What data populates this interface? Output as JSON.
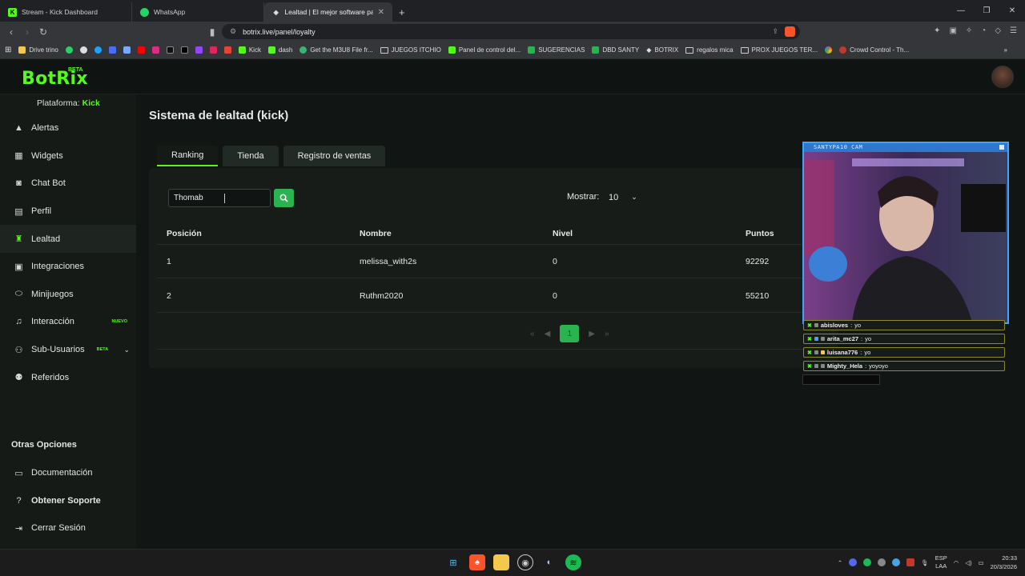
{
  "browser": {
    "tabs": [
      {
        "label": "Stream - Kick Dashboard"
      },
      {
        "label": "WhatsApp"
      },
      {
        "label": "Lealtad | El mejor software para ..."
      }
    ],
    "url": "botrix.live/panel/loyalty",
    "bookmarks": [
      {
        "label": "Drive trino"
      },
      {
        "label": "Kick"
      },
      {
        "label": "dash"
      },
      {
        "label": "Get the M3U8 File fr..."
      },
      {
        "label": "JUEGOS ITCHIO"
      },
      {
        "label": "Panel de control del..."
      },
      {
        "label": "SUGERENCIAS"
      },
      {
        "label": "DBD SANTY"
      },
      {
        "label": "BOTRIX"
      },
      {
        "label": "regalos mica"
      },
      {
        "label": "PROX JUEGOS TER..."
      },
      {
        "label": "Crowd Control - Th..."
      }
    ]
  },
  "app": {
    "logo": "BotRix",
    "logo_badge": "BETA",
    "platform_label": "Plataforma:",
    "platform_value": "Kick"
  },
  "sidebar": {
    "items": [
      {
        "label": "Alertas",
        "icon": "warning-icon"
      },
      {
        "label": "Widgets",
        "icon": "grid-icon"
      },
      {
        "label": "Chat Bot",
        "icon": "robot-icon"
      },
      {
        "label": "Perfil",
        "icon": "id-card-icon"
      },
      {
        "label": "Lealtad",
        "icon": "trophy-icon",
        "active": true
      },
      {
        "label": "Integraciones",
        "icon": "plug-icon"
      },
      {
        "label": "Minijuegos",
        "icon": "gamepad-icon"
      },
      {
        "label": "Interacción",
        "icon": "music-icon",
        "badge": "NUEVO"
      },
      {
        "label": "Sub-Usuarios",
        "icon": "users-icon",
        "badge": "BETA"
      },
      {
        "label": "Referidos",
        "icon": "referral-icon"
      }
    ],
    "other_title": "Otras Opciones",
    "other_items": [
      {
        "label": "Documentación",
        "icon": "document-icon"
      },
      {
        "label": "Obtener Soporte",
        "icon": "help-icon"
      },
      {
        "label": "Cerrar Sesión",
        "icon": "logout-icon"
      }
    ]
  },
  "main": {
    "title": "Sistema de lealtad (kick)",
    "tabs": [
      {
        "label": "Ranking",
        "active": true
      },
      {
        "label": "Tienda"
      },
      {
        "label": "Registro de ventas"
      }
    ],
    "search_value": "Thomab",
    "show_label": "Mostrar:",
    "show_value": "10",
    "table": {
      "headers": [
        "Posición",
        "Nombre",
        "Nivel",
        "Puntos"
      ],
      "rows": [
        [
          "1",
          "melissa_with2s",
          "0",
          "92292"
        ],
        [
          "2",
          "Ruthm2020",
          "0",
          "55210"
        ]
      ]
    },
    "pagination": {
      "current": "1"
    }
  },
  "overlay": {
    "cam_title": "SANTYPA10 CAM",
    "chat": [
      {
        "user": "abisloves",
        "msg": "yo"
      },
      {
        "user": "arita_mc27",
        "msg": "yo"
      },
      {
        "user": "luisana776",
        "msg": "yo"
      },
      {
        "user": "Mighty_Hela",
        "msg": "yoyoyo"
      }
    ]
  },
  "taskbar": {
    "lang_top": "ESP",
    "lang_bottom": "LAA",
    "time": "20:33",
    "date": "20/3/2026"
  },
  "colors": {
    "accent": "#53fc18",
    "button": "#2bb352",
    "cam_border": "#3fa3ff"
  }
}
